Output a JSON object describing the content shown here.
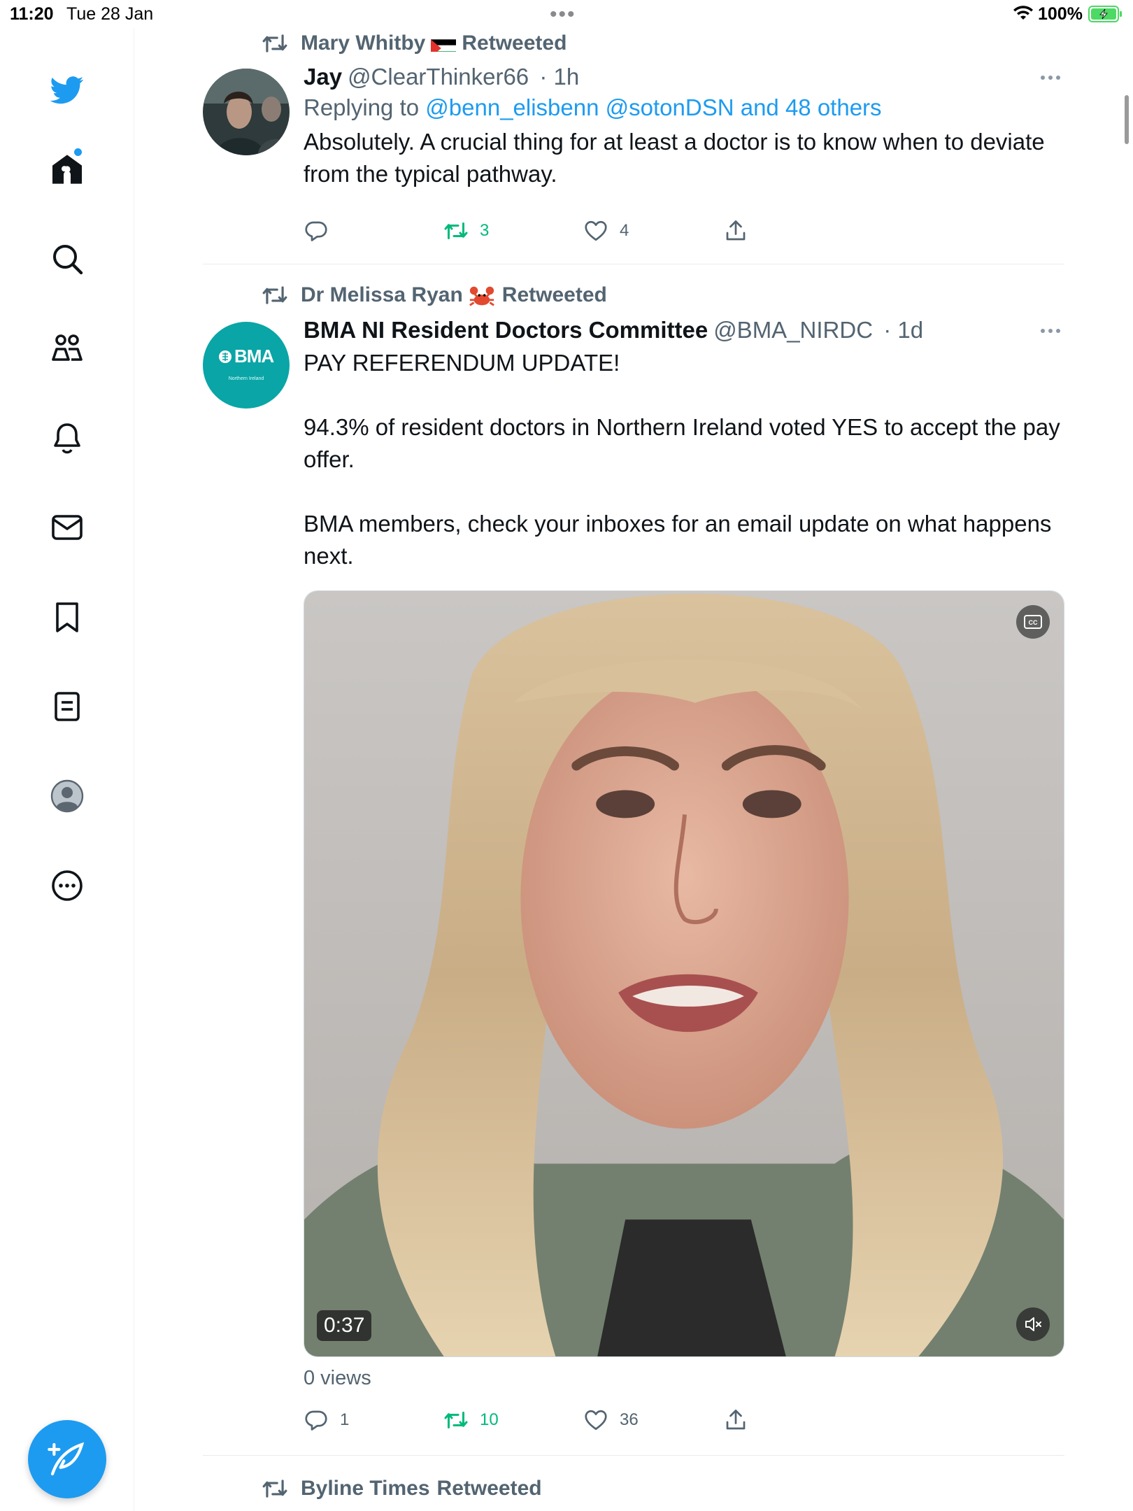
{
  "status_bar": {
    "time": "11:20",
    "date": "Tue 28 Jan",
    "battery": "100%"
  },
  "sidebar": {
    "icons": [
      "twitter-logo-icon",
      "home-icon",
      "search-icon",
      "communities-icon",
      "notifications-icon",
      "messages-icon",
      "bookmarks-icon",
      "lists-icon",
      "profile-icon",
      "more-icon"
    ],
    "compose_icon": "compose-icon",
    "accent": "#1d9bf0"
  },
  "tweets": [
    {
      "retweeted_by": "Mary Whitby",
      "retweeted_suffix": "Retweeted",
      "name": "Jay",
      "handle": "@ClearThinker66",
      "time": "· 1h",
      "replying_prefix": "Replying to",
      "replying_users": "@benn_elisbenn @sotonDSN and 48 others",
      "text": "Absolutely. A crucial thing for at least a doctor is to know when to deviate from the typical pathway.",
      "replies": "",
      "retweets": "3",
      "likes": "4"
    },
    {
      "retweeted_by": "Dr Melissa Ryan",
      "retweeted_suffix": "Retweeted",
      "name": "BMA NI Resident Doctors Committee",
      "handle": "@BMA_NIRDC",
      "time": "· 1d",
      "avatar_logo": "BMA",
      "avatar_sub": "Northern Ireland",
      "text": "PAY REFERENDUM UPDATE!\n\n94.3% of resident doctors in Northern Ireland voted YES to accept the pay offer.\n\nBMA members, check your inboxes for an email update on what happens next.",
      "video_duration": "0:37",
      "views": "0 views",
      "replies": "1",
      "retweets": "10",
      "likes": "36"
    },
    {
      "retweeted_by": "Byline Times",
      "retweeted_suffix": "Retweeted"
    }
  ],
  "colors": {
    "retweet_green": "#00ba7c",
    "muted_text": "#536471",
    "link_blue": "#1d9bf0",
    "bma_teal": "#0aa5a6"
  }
}
